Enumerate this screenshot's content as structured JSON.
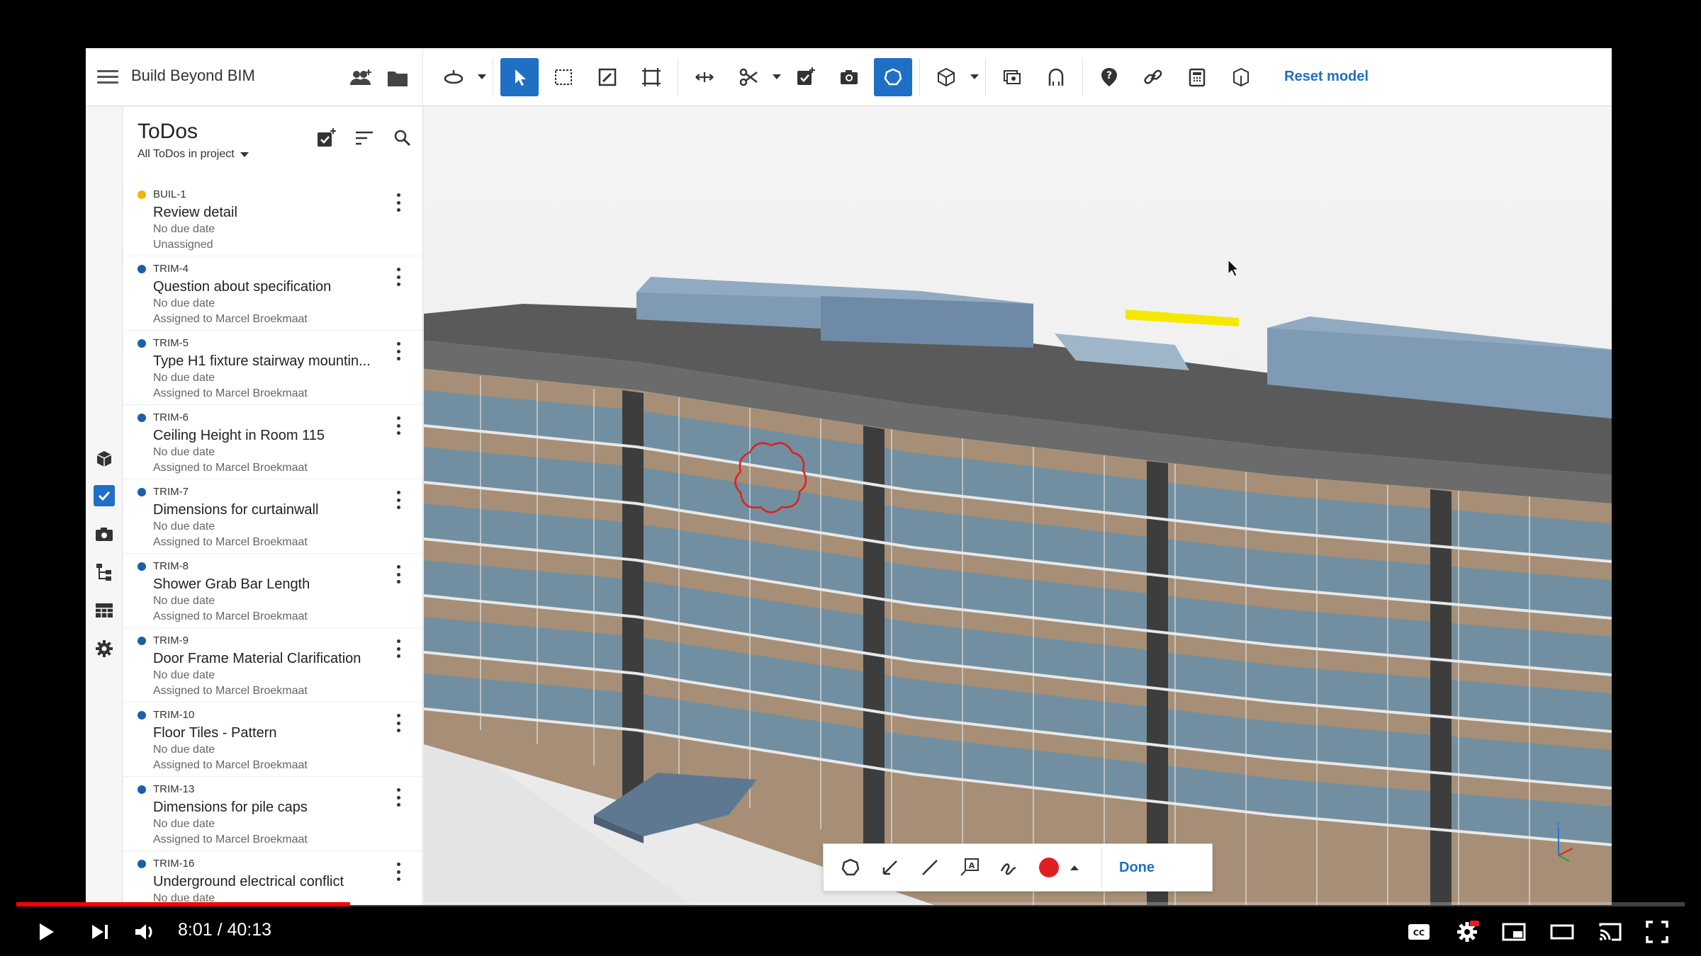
{
  "app": {
    "title": "Build Beyond BIM",
    "reset_label": "Reset model",
    "accent": "#1f6fc5"
  },
  "toolbar": {
    "tools": [
      {
        "name": "orbit-icon",
        "has_caret": true
      },
      {
        "name": "select-arrow-icon",
        "active": true
      },
      {
        "name": "box-select-icon"
      },
      {
        "name": "markup-edit-icon"
      },
      {
        "name": "section-box-icon"
      },
      {
        "name": "measure-icon"
      },
      {
        "name": "clip-scissors-icon",
        "has_caret": true
      },
      {
        "name": "add-todo-icon"
      },
      {
        "name": "camera-icon"
      },
      {
        "name": "markup-cloud-icon",
        "active": true
      },
      {
        "name": "cube-view-icon",
        "has_caret": true
      },
      {
        "name": "layers-icon"
      },
      {
        "name": "ghost-icon"
      },
      {
        "name": "help-icon"
      },
      {
        "name": "link-icon"
      },
      {
        "name": "calculator-icon"
      },
      {
        "name": "object-icon"
      }
    ]
  },
  "panel": {
    "title": "ToDos",
    "filter": "All ToDos in project",
    "todos": [
      {
        "id": "BUIL-1",
        "title": "Review detail",
        "due": "No due date",
        "assigned": "Unassigned",
        "color": "#f5b400"
      },
      {
        "id": "TRIM-4",
        "title": "Question about specification",
        "due": "No due date",
        "assigned": "Assigned to Marcel Broekmaat",
        "color": "#1a5fa8"
      },
      {
        "id": "TRIM-5",
        "title": "Type H1 fixture stairway mountin...",
        "due": "No due date",
        "assigned": "Assigned to Marcel Broekmaat",
        "color": "#1a5fa8"
      },
      {
        "id": "TRIM-6",
        "title": "Ceiling Height in Room 115",
        "due": "No due date",
        "assigned": "Assigned to Marcel Broekmaat",
        "color": "#1a5fa8"
      },
      {
        "id": "TRIM-7",
        "title": "Dimensions for curtainwall",
        "due": "No due date",
        "assigned": "Assigned to Marcel Broekmaat",
        "color": "#1a5fa8"
      },
      {
        "id": "TRIM-8",
        "title": "Shower Grab Bar Length",
        "due": "No due date",
        "assigned": "Assigned to Marcel Broekmaat",
        "color": "#1a5fa8"
      },
      {
        "id": "TRIM-9",
        "title": "Door Frame Material Clarification",
        "due": "No due date",
        "assigned": "Assigned to Marcel Broekmaat",
        "color": "#1a5fa8"
      },
      {
        "id": "TRIM-10",
        "title": "Floor Tiles - Pattern",
        "due": "No due date",
        "assigned": "Assigned to Marcel Broekmaat",
        "color": "#1a5fa8"
      },
      {
        "id": "TRIM-13",
        "title": "Dimensions for pile caps",
        "due": "No due date",
        "assigned": "Assigned to Marcel Broekmaat",
        "color": "#1a5fa8"
      },
      {
        "id": "TRIM-16",
        "title": "Underground electrical conflict",
        "due": "No due date",
        "assigned": "",
        "color": "#1a5fa8"
      }
    ]
  },
  "markup": {
    "done_label": "Done",
    "color": "#e02020"
  },
  "video": {
    "time": "8:01 / 40:13",
    "progress": 0.2
  }
}
